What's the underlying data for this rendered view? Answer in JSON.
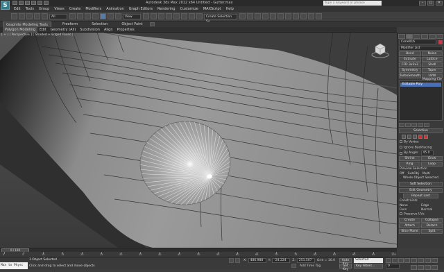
{
  "title_bar": {
    "app_logo": "S",
    "title": "Autodesk 3ds Max 2012 x64    Untitled - Gutter.max",
    "search_placeholder": "Type a keyword or phrase",
    "window_buttons": [
      "–",
      "□",
      "✕"
    ]
  },
  "menu": [
    "Edit",
    "Tools",
    "Group",
    "Views",
    "Create",
    "Modifiers",
    "Animation",
    "Graph Editors",
    "Rendering",
    "Customize",
    "MAXScript",
    "Help"
  ],
  "toolbar": {
    "filter_dropdown": "All",
    "view_dropdown": "View",
    "named_selection": "Create Selection Se"
  },
  "ribbon": {
    "tabs": [
      "Graphite Modeling Tools",
      "Freeform",
      "Selection",
      "Object Paint"
    ],
    "subtabs": [
      "Polygon Modeling",
      "Edit",
      "Geometry (All)",
      "Subdivision",
      "Align",
      "Properties"
    ]
  },
  "viewport": {
    "label": "[ + ] [ Perspective ] [ Shaded + Edged Faces ]"
  },
  "command_panel": {
    "object_name": "Cone016",
    "modifier_list": "Modifier List",
    "modifier_buttons": [
      "Bend",
      "Noise",
      "Extrude",
      "Lattice",
      "FFD 3x3x3",
      "Shell",
      "Symmetry",
      "Taper",
      "TurboSmooth",
      "UVW Mapping Cle"
    ],
    "stack_item": "Editable Poly",
    "selection_rollout": "Selection",
    "by_vertex": "By Vertex",
    "ignore_backfacing": "Ignore Backfacing",
    "by_angle": "By Angle:",
    "by_angle_value": "45.0",
    "shrink": "Shrink",
    "grow": "Grow",
    "ring": "Ring",
    "loop": "Loop",
    "preview_selection": "Preview Selection",
    "preview_options": [
      "Off",
      "SubObj",
      "Multi"
    ],
    "whole_object_selected": "Whole Object Selected",
    "soft_selection": "Soft Selection",
    "edit_geometry": "Edit Geometry",
    "repeat_last": "Repeat Last",
    "constraints": "Constraints",
    "constraint_options": [
      "None",
      "Edge",
      "Face",
      "Normal"
    ],
    "preserve_uvs": "Preserve UVs",
    "create": "Create",
    "collapse": "Collapse",
    "attach": "Attach",
    "detach": "Detach",
    "slice_plane": "Slice Plane",
    "split": "Split"
  },
  "timeline": {
    "slider": "0 / 100",
    "ticks": [
      "0",
      "5",
      "10",
      "15",
      "20",
      "25",
      "30",
      "35",
      "40",
      "45",
      "50",
      "55",
      "60",
      "65",
      "70",
      "75",
      "80",
      "85",
      "90",
      "95",
      "100"
    ]
  },
  "status": {
    "listener": "Max to Physc",
    "selection": "1 Object Selected",
    "prompt": "Click and drag to select and move objects",
    "x_label": "X:",
    "x_value": "486.988",
    "y_label": "Y:",
    "y_value": "-24.224",
    "z_label": "Z:",
    "z_value": "251.507",
    "grid": "Grid = 10.0",
    "add_time_tag": "Add Time Tag",
    "auto_key": "Auto Key",
    "set_key": "Set Key",
    "selected": "Selected",
    "key_filters": "Key Filters...",
    "frame": "0"
  }
}
